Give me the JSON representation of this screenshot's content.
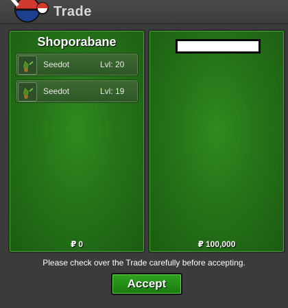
{
  "window": {
    "title": "Trade"
  },
  "left_panel": {
    "player_name": "Shoporabane",
    "items": [
      {
        "name": "Seedot",
        "level": "Lvl: 20",
        "icon": "seedot-icon"
      },
      {
        "name": "Seedot",
        "level": "Lvl: 19",
        "icon": "seedot-icon"
      }
    ],
    "money": "0"
  },
  "right_panel": {
    "player_name": "",
    "items": [],
    "money": "100,000"
  },
  "currency_symbol": "₽",
  "notice": "Please check over the Trade carefully before accepting.",
  "accept_label": "Accept",
  "colors": {
    "panel": "#257318",
    "accept": "#1b7a10",
    "window": "#3b3b3b"
  }
}
